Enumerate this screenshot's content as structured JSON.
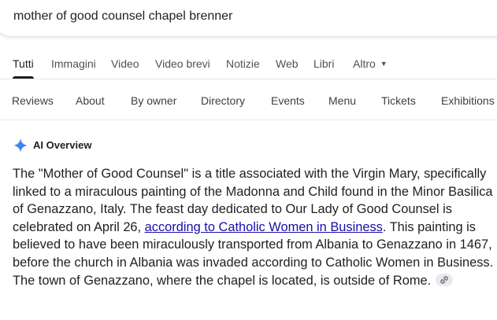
{
  "search": {
    "query": "mother of good counsel chapel brenner"
  },
  "tabs": [
    {
      "label": "Tutti",
      "active": true
    },
    {
      "label": "Immagini"
    },
    {
      "label": "Video"
    },
    {
      "label": "Video brevi"
    },
    {
      "label": "Notizie"
    },
    {
      "label": "Web"
    },
    {
      "label": "Libri"
    },
    {
      "label": "Altro"
    }
  ],
  "chips": [
    "Reviews",
    "About",
    "By owner",
    "Directory",
    "Events",
    "Menu",
    "Tickets",
    "Exhibitions"
  ],
  "ai_overview": {
    "title": "AI Overview",
    "text_1": "The \"Mother of Good Counsel\" is a title associated with the Virgin Mary, specifically linked to a miraculous painting of the Madonna and Child found in the Minor Basilica of Genazzano, Italy. The feast day dedicated to Our Lady of Good Counsel is celebrated on April 26, ",
    "link_text": "according to Catholic Women in Business",
    "text_2": ". This painting is believed to have been miraculously transported from Albania to Genazzano in 1467, before the church in Albania was invaded according to Catholic Women in Business. The town of Genazzano, where the chapel is located, is outside of Rome.",
    "link_icon": "link-icon"
  },
  "colors": {
    "link": "#1a0dab",
    "ai_star_blue": "#4285f4",
    "text": "#1f1f1f"
  }
}
